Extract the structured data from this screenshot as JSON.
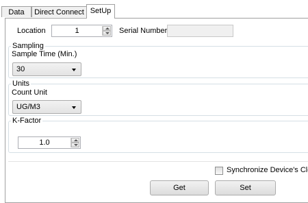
{
  "tabs": [
    "Data",
    "Direct Connect",
    "SetUp"
  ],
  "location": {
    "label": "Location",
    "value": "1"
  },
  "serial_number": {
    "label": "Serial Number",
    "value": ""
  },
  "sampling": {
    "group_title": "Sampling",
    "sample_time_label": "Sample Time (Min.)",
    "sample_time_value": "30"
  },
  "units": {
    "group_title": "Units",
    "count_unit_label": "Count Unit",
    "count_unit_value": "UG/M3"
  },
  "kfactor": {
    "group_title": "K-Factor",
    "value": "1.0"
  },
  "sync_clock": {
    "label": "Synchronize Device's Clock",
    "checked": false
  },
  "buttons": {
    "get": "Get",
    "set": "Set"
  }
}
